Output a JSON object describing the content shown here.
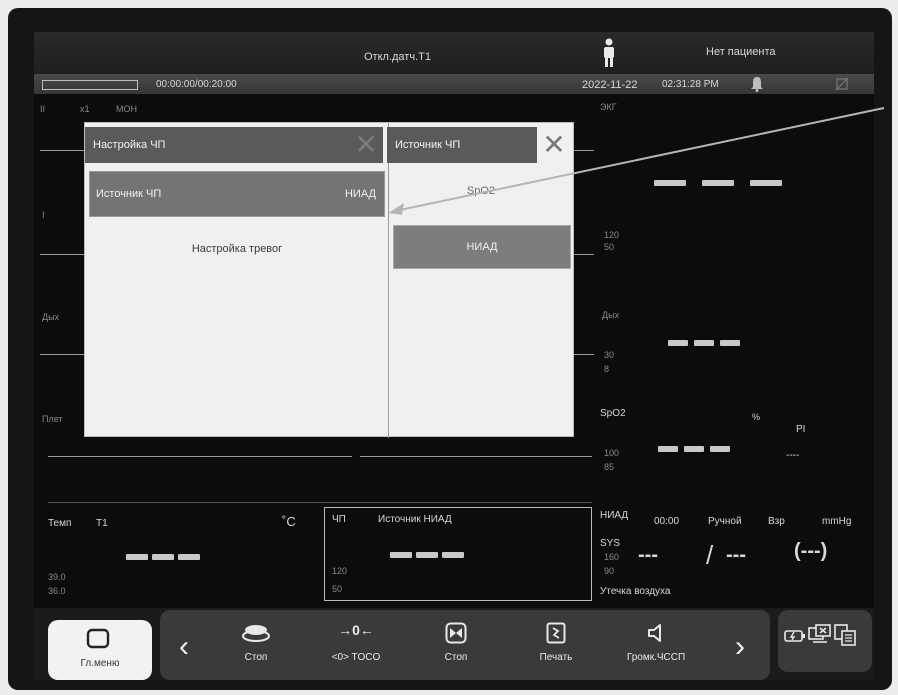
{
  "header": {
    "sensor_message": "Откл.датч.Т1",
    "patient_status": "Нет пациента",
    "timer": "00:00:00/00:20:00",
    "date": "2022-11-22",
    "time": "02:31:28 PM"
  },
  "waveform_area": {
    "lead_label": "II",
    "gain": "x1",
    "filter": "МОН",
    "lead_I_label": "I",
    "resp_label": "Дых",
    "pleth_label": "Плет"
  },
  "dialog": {
    "left_title": "Настройка ЧП",
    "right_title": "Источник ЧП",
    "hr_source_label": "Источник ЧП",
    "hr_source_value": "НИАД",
    "alarm_setup": "Настройка тревог",
    "options": [
      "SpO2",
      "НИАД"
    ]
  },
  "params": {
    "ecg": {
      "label": "ЭКГ",
      "upper": "120",
      "lower": "50"
    },
    "resp": {
      "label": "Дых",
      "upper": "30",
      "lower": "8"
    },
    "spo2": {
      "label": "SpO2",
      "unit": "%",
      "pi_label": "PI",
      "pi_value": "----",
      "upper": "100",
      "lower": "85"
    },
    "temp": {
      "label": "Темп",
      "channel": "T1",
      "unit": "˚C",
      "upper": "39.0",
      "lower": "36.0"
    },
    "hr": {
      "label": "ЧП",
      "source": "Источник НИАД",
      "upper": "120",
      "lower": "50"
    },
    "nibp": {
      "label": "НИАД",
      "time": "00:00",
      "mode": "Ручной",
      "category": "Взр",
      "unit": "mmHg",
      "sys_label": "SYS",
      "upper": "160",
      "lower": "90",
      "sys_value": "---",
      "separator": "/",
      "dia_value": "---",
      "map_value": "(---)",
      "status": "Утечка воздуха"
    }
  },
  "toolbar": {
    "main_menu": "Гл.меню",
    "items": [
      {
        "label": "Стоп",
        "icon": "nibp-cuff-icon"
      },
      {
        "label": "<0> TOCO",
        "icon": "toco-zero-icon"
      },
      {
        "label": "Стоп",
        "icon": "stop-icon"
      },
      {
        "label": "Печать",
        "icon": "print-icon"
      },
      {
        "label": "Громк.ЧССП",
        "icon": "speaker-icon"
      }
    ]
  },
  "colors": {
    "screen": "#0c0c0c",
    "dialog": "#f0f0f0",
    "dialog_title": "#5a5a5a",
    "selected_row": "#747474",
    "toolbar": "#3a3a3a"
  }
}
